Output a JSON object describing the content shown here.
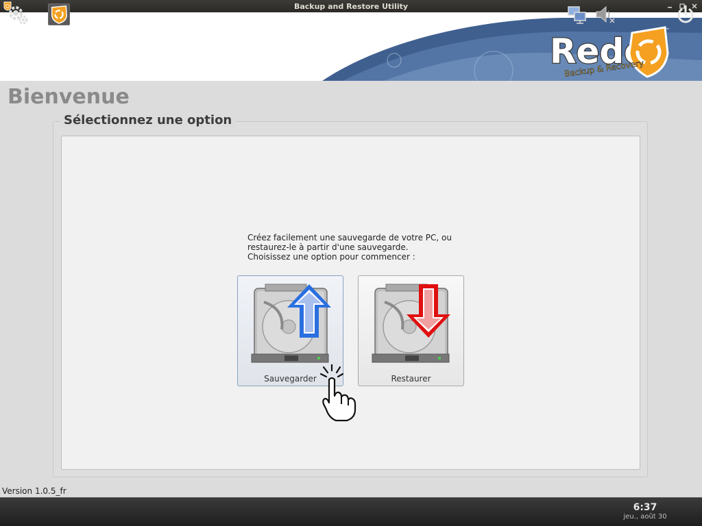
{
  "window": {
    "title": "Backup and Restore Utility"
  },
  "brand": {
    "logo_text": "Redo",
    "tagline": "Backup & Recovery",
    "trademark": "™"
  },
  "page": {
    "title": "Bienvenue",
    "group_title": "Sélectionnez une option",
    "intro_lines": [
      "Créez facilement une sauvegarde de votre PC, ou",
      "restaurez-le à partir d'une sauvegarde.",
      "Choisissez une option pour commencer :"
    ]
  },
  "options": {
    "backup_label": "Sauvegarder",
    "restore_label": "Restaurer"
  },
  "footer": {
    "version": "Version 1.0.5_fr"
  },
  "taskbar": {
    "time": "6:37",
    "date": "jeu., août 30"
  },
  "colors": {
    "accent_orange": "#f5a020",
    "arrow_blue": "#2a6fe0",
    "arrow_red": "#e01010",
    "banner_wave": "#3f5f8f"
  },
  "icons": [
    "app-logo-icon",
    "minimize-icon",
    "maximize-icon",
    "close-icon",
    "hard-drive-icon",
    "up-arrow-icon",
    "down-arrow-icon",
    "hand-cursor-icon",
    "settings-gear-icon",
    "network-icon",
    "volume-muted-icon",
    "power-icon"
  ]
}
